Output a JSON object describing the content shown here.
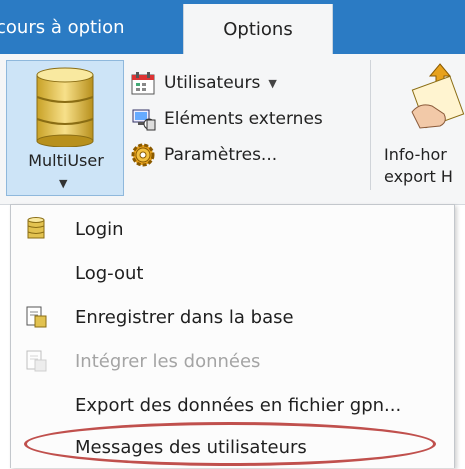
{
  "tabs": [
    {
      "label": "cours à option"
    },
    {
      "label": "Options"
    }
  ],
  "ribbon": {
    "multiuser": {
      "label": "MultiUser"
    },
    "commands": [
      {
        "label": "Utilisateurs",
        "icon": "users-calendar-icon",
        "has_dropdown": true
      },
      {
        "label": "Eléments externes",
        "icon": "external-elements-icon"
      },
      {
        "label": "Paramètres...",
        "icon": "gear-icon"
      }
    ],
    "infohor": {
      "label_line1": "Info-hor",
      "label_line2": "export H"
    }
  },
  "menu": {
    "items": [
      {
        "label": "Login",
        "icon": "database-icon",
        "enabled": true
      },
      {
        "label": "Log-out",
        "icon": "",
        "enabled": true
      },
      {
        "label": "Enregistrer dans la base",
        "icon": "document-save-icon",
        "enabled": true
      },
      {
        "label": "Intégrer les données",
        "icon": "document-import-icon",
        "enabled": false
      },
      {
        "label": "Export des données en fichier gpn...",
        "icon": "",
        "enabled": true
      },
      {
        "label": "Messages des utilisateurs",
        "icon": "",
        "enabled": true,
        "highlighted": true
      }
    ]
  },
  "colors": {
    "tab_bar": "#2b7bc4",
    "ribbon_bg": "#f5f6f7",
    "button_hover_bg": "#cde4f7",
    "disabled_text": "#a4a4a4",
    "highlight_ellipse": "#c0504d"
  }
}
